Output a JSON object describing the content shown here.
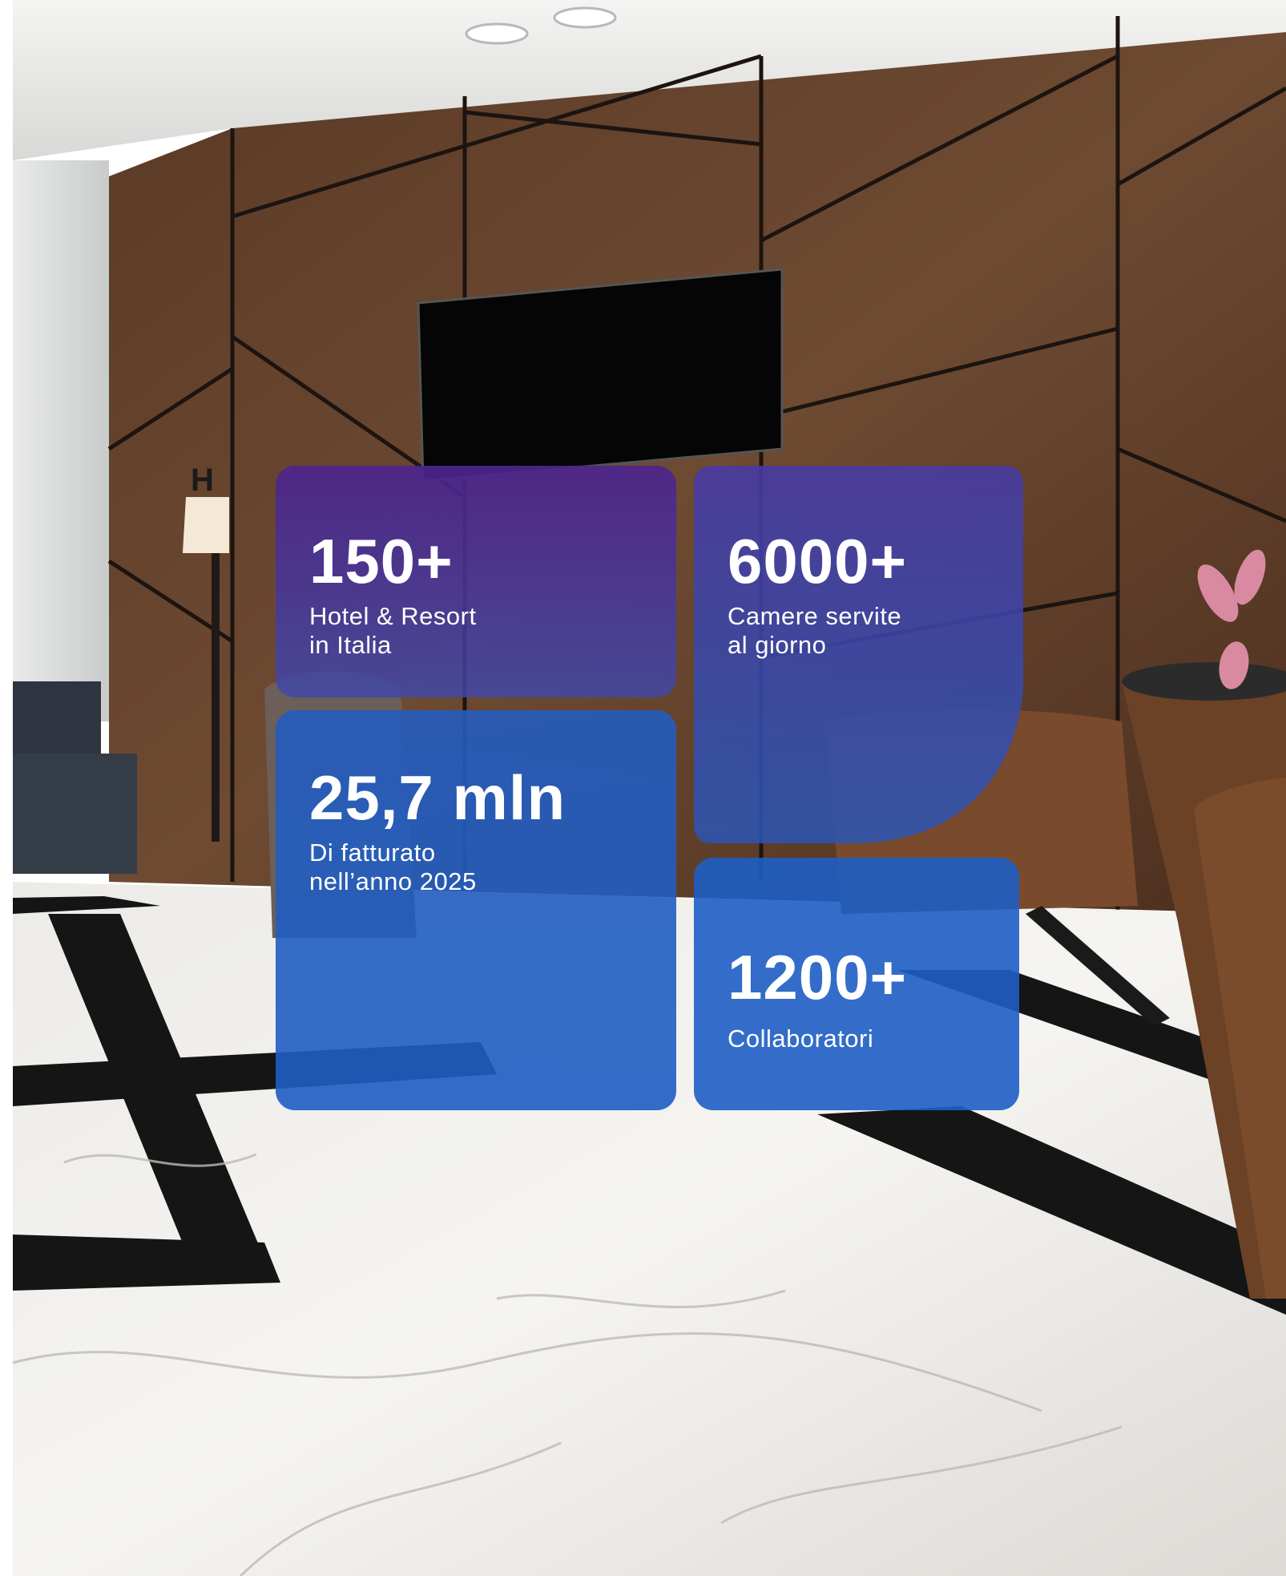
{
  "stats": [
    {
      "value": "150+",
      "label": "Hotel & Resort\nin Italia"
    },
    {
      "value": "6000+",
      "label": "Camere servite\nal giorno"
    },
    {
      "value": "25,7 mln",
      "label": "Di fatturato\nnell’anno 2025"
    },
    {
      "value": "1200+",
      "label": "Collaboratori"
    }
  ],
  "colors": {
    "card_purple": "#4d248c",
    "card_blue": "#1e5ec4",
    "text": "#ffffff"
  }
}
